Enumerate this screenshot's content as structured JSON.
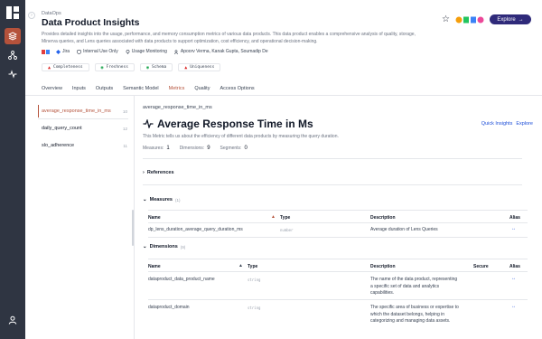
{
  "header": {
    "breadcrumb": "DataOps",
    "title": "Data Product Insights",
    "description": "Provides detailed insights into the usage, performance, and memory consumption metrics of various data products. This data product enables a comprehensive analysis of quality, storage, Minerva queries, and Lens queries associated with data products to support optimization, cost efficiency, and operational decision-making.",
    "meta": {
      "jira": "Jira",
      "visibility": "Internal Use Only",
      "monitoring": "Usage Monitoring",
      "owners": "Apoorv Verma, Kanak Gupta, Soumadip De"
    },
    "checks": [
      "Completeness",
      "Freshness",
      "Schema",
      "Uniqueness"
    ],
    "explore_label": "Explore"
  },
  "tabs": [
    "Overview",
    "Inputs",
    "Outputs",
    "Semantic Model",
    "Metrics",
    "Quality",
    "Access Options"
  ],
  "sidebar": {
    "items": [
      {
        "label": "average_response_time_in_ms",
        "count": "10"
      },
      {
        "label": "daily_query_count",
        "count": "12"
      },
      {
        "label": "slo_adherence",
        "count": "11"
      }
    ]
  },
  "metric": {
    "id": "average_response_time_in_ms",
    "title": "Average Response Time in Ms",
    "quick_insights": "Quick Insights",
    "explore": "Explore",
    "description": "This Metric tells us about the efficiency of different data products by measuring the query duration.",
    "stats": {
      "measures_label": "Measures:",
      "measures_value": "1",
      "dimensions_label": "Dimensions:",
      "dimensions_value": "9",
      "segments_label": "Segments:",
      "segments_value": "0"
    }
  },
  "references": {
    "title": "References"
  },
  "measures": {
    "title": "Measures",
    "count": "(1)",
    "headers": {
      "name": "Name",
      "type": "Type",
      "description": "Description",
      "alias": "Alias"
    },
    "rows": [
      {
        "name": "dp_lens_duration_average_query_duration_ms",
        "type": "number",
        "description": "Average duration of Lens Queries",
        "alias": "↔"
      }
    ]
  },
  "dimensions": {
    "title": "Dimensions",
    "count": "(9)",
    "headers": {
      "name": "Name",
      "type": "Type",
      "description": "Description",
      "secure": "Secure",
      "alias": "Alias"
    },
    "rows": [
      {
        "name": "dataproduct_data_product_name",
        "type": "string",
        "description": "The name of the data product, representing a specific set of data and analytics capabilities.",
        "alias": "↔"
      },
      {
        "name": "dataproduct_domain",
        "type": "string",
        "description": "The specific area of business or expertise to which the dataset belongs, helping in categorizing and managing data assets.",
        "alias": "↔"
      }
    ]
  },
  "colors": {
    "accent": "#b5523b",
    "rail": "#2f3542",
    "explore": "#2f2a7a",
    "link": "#1d4ed8"
  }
}
